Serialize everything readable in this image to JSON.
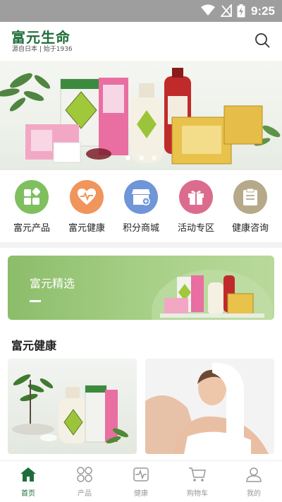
{
  "status_bar": {
    "time": "9:25"
  },
  "header": {
    "logo_title": "富元生命",
    "logo_subtitle": "源自日本 | 始于1936",
    "search_icon": "search-icon"
  },
  "banner": {
    "slides": 3,
    "active_slide": 1
  },
  "menu": [
    {
      "label": "富元产品",
      "icon": "grid-icon",
      "color": "#7fbf5e"
    },
    {
      "label": "富元健康",
      "icon": "heart-icon",
      "color": "#f0955c"
    },
    {
      "label": "积分商城",
      "icon": "store-icon",
      "color": "#6e96d8"
    },
    {
      "label": "活动专区",
      "icon": "gift-icon",
      "color": "#dc6c8e"
    },
    {
      "label": "健康咨询",
      "icon": "clipboard-icon",
      "color": "#b5a98a"
    }
  ],
  "promo": {
    "title": "富元精选"
  },
  "section": {
    "title": "富元健康"
  },
  "tabbar": [
    {
      "label": "首页",
      "icon": "home-icon",
      "active": true
    },
    {
      "label": "产品",
      "icon": "clover-icon",
      "active": false
    },
    {
      "label": "健康",
      "icon": "heartbeat-icon",
      "active": false
    },
    {
      "label": "购物车",
      "icon": "cart-icon",
      "active": false
    },
    {
      "label": "我的",
      "icon": "user-icon",
      "active": false
    }
  ],
  "colors": {
    "brand_green": "#1f6e3a",
    "status_bar": "#9e9e9e",
    "promo_green": "#8cbd6a"
  }
}
